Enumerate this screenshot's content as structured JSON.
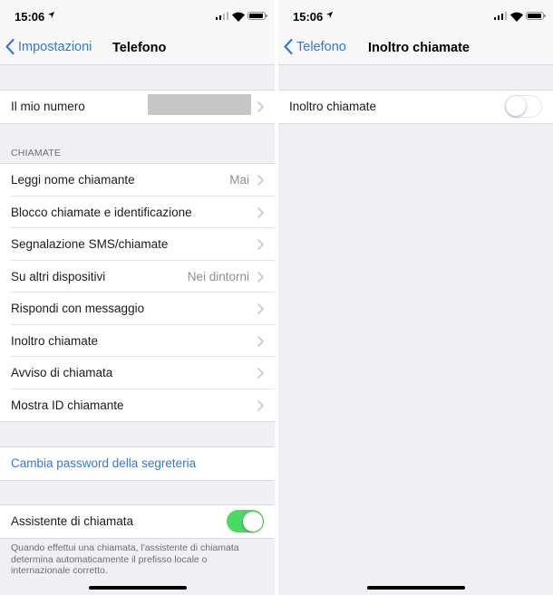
{
  "left": {
    "status": {
      "time": "15:06"
    },
    "nav": {
      "back_label": "Impostazioni",
      "title": "Telefono"
    },
    "my_number": {
      "label": "Il mio numero"
    },
    "section_header": "CHIAMATE",
    "call_rows": [
      {
        "label": "Leggi nome chiamante",
        "value": "Mai"
      },
      {
        "label": "Blocco chiamate e identificazione",
        "value": ""
      },
      {
        "label": "Segnalazione SMS/chiamate",
        "value": ""
      },
      {
        "label": "Su altri dispositivi",
        "value": "Nei dintorni"
      },
      {
        "label": "Rispondi con messaggio",
        "value": ""
      },
      {
        "label": "Inoltro chiamate",
        "value": ""
      },
      {
        "label": "Avviso di chiamata",
        "value": ""
      },
      {
        "label": "Mostra ID chiamante",
        "value": ""
      }
    ],
    "voicemail": {
      "label": "Cambia password della segreteria"
    },
    "assistant": {
      "label": "Assistente di chiamata",
      "enabled": true,
      "footer": "Quando effettui una chiamata, l'assistente di chiamata determina automaticamente il prefisso locale o internazionale corretto."
    }
  },
  "right": {
    "status": {
      "time": "15:06"
    },
    "nav": {
      "back_label": "Telefono",
      "title": "Inoltro chiamate"
    },
    "forwarding": {
      "label": "Inoltro chiamate",
      "enabled": false
    }
  },
  "colors": {
    "accent": "#2f7ad9",
    "toggle_on": "#4cd964",
    "background": "#efeff4"
  }
}
